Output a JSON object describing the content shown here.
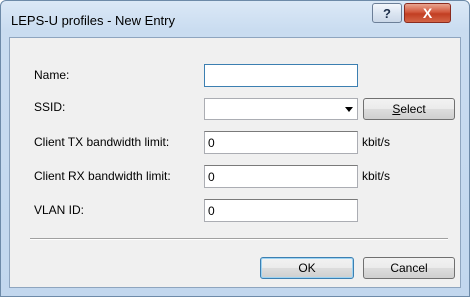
{
  "window": {
    "title": "LEPS-U profiles - New Entry",
    "help_glyph": "?",
    "close_glyph": "X"
  },
  "form": {
    "name_label": "Name:",
    "name_value": "",
    "ssid_label": "SSID:",
    "ssid_value": "",
    "select_button_accel": "S",
    "select_button_rest": "elect",
    "tx_label": "Client TX bandwidth limit:",
    "tx_value": "0",
    "tx_unit": "kbit/s",
    "rx_label": "Client RX bandwidth limit:",
    "rx_value": "0",
    "rx_unit": "kbit/s",
    "vlan_label": "VLAN ID:",
    "vlan_value": "0"
  },
  "buttons": {
    "ok": "OK",
    "cancel": "Cancel"
  }
}
